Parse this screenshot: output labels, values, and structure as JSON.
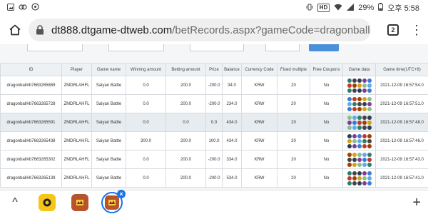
{
  "status_bar": {
    "hd_badge": "HD",
    "battery": "29%",
    "time": "오후 5:58"
  },
  "browser": {
    "url_host": "dt888.dtgame-dtweb.com",
    "url_path": "/betRecords.aspx?gameCode=dragonball",
    "tab_count": "2",
    "menu_glyph": "⋮"
  },
  "table": {
    "headers": [
      "ID",
      "Player",
      "Game name",
      "Winning amount",
      "Betting amount",
      "Prize",
      "Balance",
      "Currency Code",
      "Fixed multiple",
      "Free Coupons",
      "Game data",
      "Game time(UTC+8)"
    ],
    "rows": [
      [
        "dragonball#b7663265869",
        "ZMDRLAHFL",
        "Saiyan Battle",
        "0.0",
        "200.0",
        "-200.0",
        "34.0",
        "KRW",
        "20",
        "No",
        "",
        "2021-12-09 16:57:54.0"
      ],
      [
        "dragonball#b7663265728",
        "ZMDRLAHFL",
        "Saiyan Battle",
        "0.0",
        "200.0",
        "-200.0",
        "234.0",
        "KRW",
        "20",
        "No",
        "",
        "2021-12-09 16:57:51.0"
      ],
      [
        "dragonball#b7663265591",
        "ZMDRLAHFL",
        "Saiyan Battle",
        "0.0",
        "0.0",
        "0.0",
        "434.0",
        "KRW",
        "20",
        "No",
        "",
        "2021-12-09 16:57:48.0"
      ],
      [
        "dragonball#b7663265438",
        "ZMDRLAHFL",
        "Saiyan Battle",
        "300.0",
        "200.0",
        "100.0",
        "434.0",
        "KRW",
        "20",
        "No",
        "",
        "2021-12-09 16:57:46.0"
      ],
      [
        "dragonball#b7663265302",
        "ZMDRLAHFL",
        "Saiyan Battle",
        "0.0",
        "200.0",
        "-200.0",
        "334.0",
        "KRW",
        "20",
        "No",
        "",
        "2021-12-09 16:57:43.0"
      ],
      [
        "dragonball#b7663265139",
        "ZMDRLAHFL",
        "Saiyan Battle",
        "0.0",
        "200.0",
        "-200.0",
        "534.0",
        "KRW",
        "20",
        "No",
        "",
        "2021-12-09 16:57:41.0"
      ]
    ],
    "game_data_colors": [
      "#2e7d6b",
      "#d4a017",
      "#3a7bd5",
      "#444444",
      "#8fbc8f",
      "#c0392b",
      "#2c3e50",
      "#5dade2",
      "#a04000",
      "#7d3c98"
    ]
  },
  "bottom_bar": {
    "chevron_glyph": "^",
    "plus_glyph": "+",
    "close_glyph": "×"
  }
}
